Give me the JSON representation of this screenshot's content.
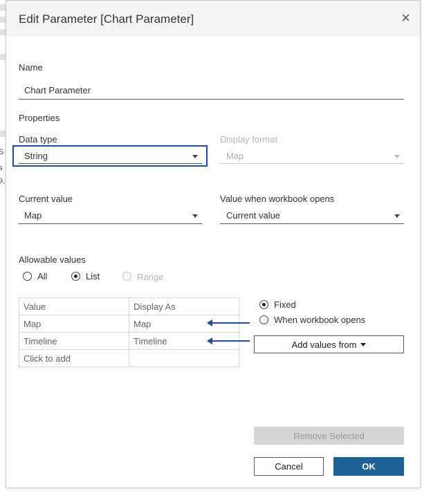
{
  "dialog": {
    "title": "Edit Parameter [Chart Parameter]",
    "close_glyph": "×"
  },
  "name": {
    "label": "Name",
    "value": "Chart Parameter"
  },
  "properties": {
    "heading": "Properties",
    "data_type": {
      "label": "Data type",
      "value": "String"
    },
    "display_format": {
      "label": "Display format",
      "value": "Map",
      "enabled": false
    },
    "current_value": {
      "label": "Current value",
      "value": "Map"
    },
    "value_when_opens": {
      "label": "Value when workbook opens",
      "value": "Current value"
    }
  },
  "allowable_values": {
    "label": "Allowable values",
    "options": [
      {
        "label": "All",
        "checked": false,
        "enabled": true
      },
      {
        "label": "List",
        "checked": true,
        "enabled": true
      },
      {
        "label": "Range",
        "checked": false,
        "enabled": false
      }
    ]
  },
  "list_table": {
    "headers": [
      "Value",
      "Display As"
    ],
    "rows": [
      [
        "Map",
        "Map"
      ],
      [
        "Timeline",
        "Timeline"
      ],
      [
        "Click to add",
        ""
      ]
    ]
  },
  "fixed_options": [
    {
      "label": "Fixed",
      "checked": true
    },
    {
      "label": "When workbook opens",
      "checked": false
    }
  ],
  "buttons": {
    "add_values_from": "Add values from",
    "remove_selected": "Remove Selected",
    "cancel": "Cancel",
    "ok": "OK"
  },
  "background_fragments": [
    "S",
    "s",
    "9,"
  ],
  "colors": {
    "accent": "#1f4e96",
    "primary_button": "#1d6296",
    "titlebar": "#f5f5f5"
  },
  "icons": {
    "close": "close-icon",
    "dropdown": "chevron-down-icon",
    "annotation": "arrow-left-icon"
  }
}
